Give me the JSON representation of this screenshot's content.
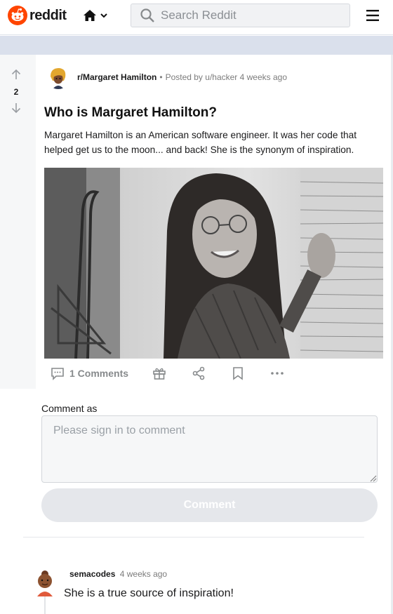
{
  "header": {
    "logo_text": "reddit",
    "search_placeholder": "Search Reddit",
    "icons": {
      "logo": "reddit-alien-icon",
      "home": "home-icon",
      "dropdown": "chevron-down-icon",
      "search": "search-icon",
      "menu": "hamburger-icon"
    }
  },
  "post": {
    "vote_count": "2",
    "subreddit": "r/Margaret Hamilton",
    "separator": "•",
    "posted_by": "Posted by u/hacker 4 weeks ago",
    "title": "Who is Margaret Hamilton?",
    "body": "Margaret Hamilton is an American software engineer. It was her code that helped get us to the moon... and back! She is the synonym of inspiration.",
    "actions": {
      "comments_label": "1 Comments"
    }
  },
  "comment_form": {
    "label": "Comment as",
    "placeholder": "Please sign in to comment",
    "submit_label": "Comment"
  },
  "comments": [
    {
      "author": "semacodes",
      "time": "4 weeks ago",
      "text": "She is a true source of inspiration!"
    }
  ],
  "colors": {
    "brand": "#ff4500",
    "muted": "#878a8c",
    "band": "#dae0ec"
  }
}
